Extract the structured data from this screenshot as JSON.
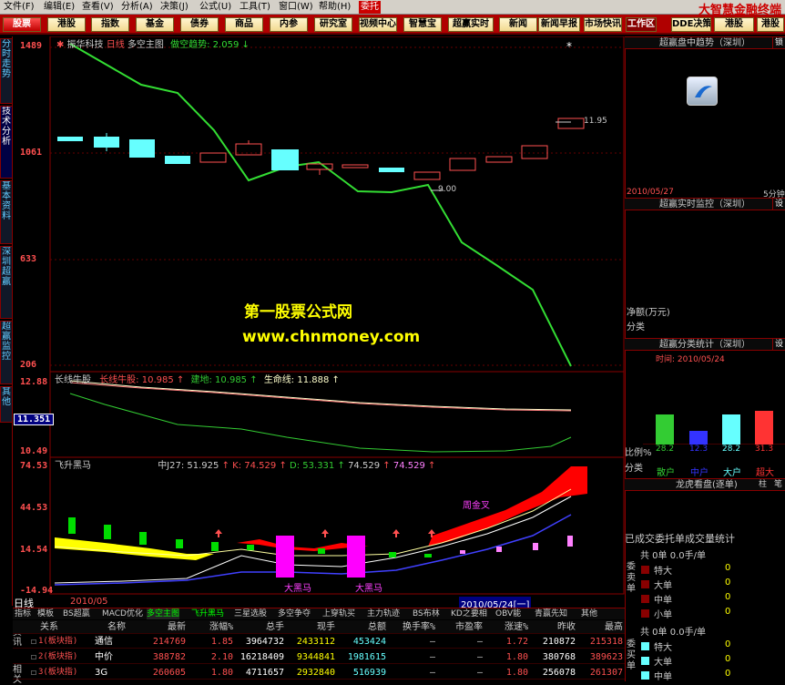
{
  "menu": {
    "items": [
      "文件(F)",
      "编辑(E)",
      "查看(V)",
      "分析(A)",
      "决策(J)",
      "公式(U)",
      "工具(T)",
      "窗口(W)",
      "帮助(H)"
    ],
    "weituo": "委托",
    "brand": "大智慧金融终端"
  },
  "toolbar": {
    "buttons": [
      "股票",
      "港股",
      "指数",
      "基金",
      "债券",
      "商品",
      "内参",
      "研究室",
      "视频中心",
      "智慧宝",
      "超赢实时",
      "新闻",
      "新闻早报",
      "市场快讯"
    ],
    "right_buttons": [
      "工作区",
      "DDE决策",
      "港股",
      "港股"
    ]
  },
  "left_tabs": [
    "分时走势",
    "技术分析",
    "基本资料",
    "深圳超赢",
    "超赢监控",
    "其他"
  ],
  "main_chart": {
    "stock_name": "振华科技",
    "period": "日线",
    "indicator_label": "多空主图",
    "indicator_value": "做空趋势: 2.059",
    "arrow_down": "↓",
    "axis_labels": [
      "1489",
      "1061",
      "633",
      "206"
    ],
    "label_high": "11.95",
    "label_low": "9.00",
    "marker_star": "*"
  },
  "panel2": {
    "name": "长线牛股",
    "line1": "长线牛股: 10.985",
    "line2": "建地: 10.985",
    "line3": "生命线: 11.888",
    "arrow_up": "↑",
    "axis_top": "12.88",
    "axis_cur": "11.351",
    "axis_bot": "10.49"
  },
  "panel3": {
    "name": "飞升黑马",
    "line_a": "中J27: 51.925",
    "line_k": "K: 74.529",
    "line_d": "D: 53.331",
    "line_e": "74.529",
    "line_f": "74.529",
    "arrow_up": "↑",
    "axis": [
      "74.53",
      "44.53",
      "14.54",
      "-14.94"
    ],
    "bull_label": "周金叉",
    "bear_label": "大黑马"
  },
  "date_bar": {
    "period": "日线",
    "date_left": "2010/05",
    "date_right": "2010/05/24[一]"
  },
  "bottom_tabs": [
    "指标",
    "模板",
    "BS超赢",
    "MACD优化",
    "多空主图",
    "飞升黑马",
    "三星选股",
    "多空争夺",
    "上穿轨买",
    "主力轨迹",
    "BS布林",
    "KD之要相",
    "OBV能",
    "青赢先知",
    "其他"
  ],
  "table": {
    "headers": [
      "关系",
      "名称",
      "最新",
      "涨幅%",
      "总手",
      "现手",
      "总额",
      "换手率%",
      "市盈率",
      "涨速%",
      "昨收",
      "最高"
    ],
    "rows": [
      {
        "rel": "1(板块指)",
        "name": "通信",
        "last": "214769",
        "chg": "1.85",
        "vol": "3964732",
        "cur": "2433112",
        "amt": "453424",
        "turn": "—",
        "pe": "—",
        "spd": "1.72",
        "prev": "210872",
        "high": "215318"
      },
      {
        "rel": "2(板块指)",
        "name": "中价",
        "last": "388782",
        "chg": "2.10",
        "vol": "16218409",
        "cur": "9344841",
        "amt": "1981615",
        "turn": "—",
        "pe": "—",
        "spd": "1.80",
        "prev": "380768",
        "high": "389623"
      },
      {
        "rel": "3(板块指)",
        "name": "3G",
        "last": "260605",
        "chg": "1.80",
        "vol": "4711657",
        "cur": "2932840",
        "amt": "516939",
        "turn": "—",
        "pe": "—",
        "spd": "1.80",
        "prev": "256078",
        "high": "261307"
      }
    ],
    "side_label": "资讯",
    "side_label2": "相关"
  },
  "watermark": {
    "line1": "第一股票公式网",
    "line2": "www.chnmoney.com"
  },
  "right_panel": {
    "trend_title": "超赢盘中趋势（深圳）",
    "trend_side": "锁",
    "trend_date": "2010/05/27",
    "trend_period": "5分钟",
    "monitor_title": "超赢实时监控（深圳）",
    "monitor_side": "设",
    "net_label": "净额(万元)",
    "class_label": "分类",
    "stat_title": "超赢分类统计（深圳）",
    "stat_side": "设",
    "stat_time": "时间: 2010/05/24",
    "ratio_label": "比例%",
    "bar_values": [
      "28.2",
      "12.3",
      "28.2",
      "31.3"
    ],
    "class_label2": "分类",
    "classes": [
      "散户",
      "中户",
      "大户",
      "超大"
    ],
    "dragon_title": "龙虎看盘(逐单)",
    "dragon_side": "柱",
    "dragon_side2": "笔",
    "summary_title": "已成交委托单成交量统计",
    "sell_head": "共 0单 0.0手/单",
    "sell_side": "委卖单",
    "sell_rows": [
      {
        "label": "特大",
        "val": "0"
      },
      {
        "label": "大单",
        "val": "0"
      },
      {
        "label": "中单",
        "val": "0"
      },
      {
        "label": "小单",
        "val": "0"
      }
    ],
    "buy_head": "共 0单 0.0手/单",
    "buy_side": "委买单",
    "buy_rows": [
      {
        "label": "特大",
        "val": "0"
      },
      {
        "label": "大单",
        "val": "0"
      },
      {
        "label": "中单",
        "val": "0"
      }
    ],
    "colors": {
      "retail": "#33cc33",
      "mid": "#3333ff",
      "large": "#66ffff",
      "super": "#ff3333"
    }
  }
}
